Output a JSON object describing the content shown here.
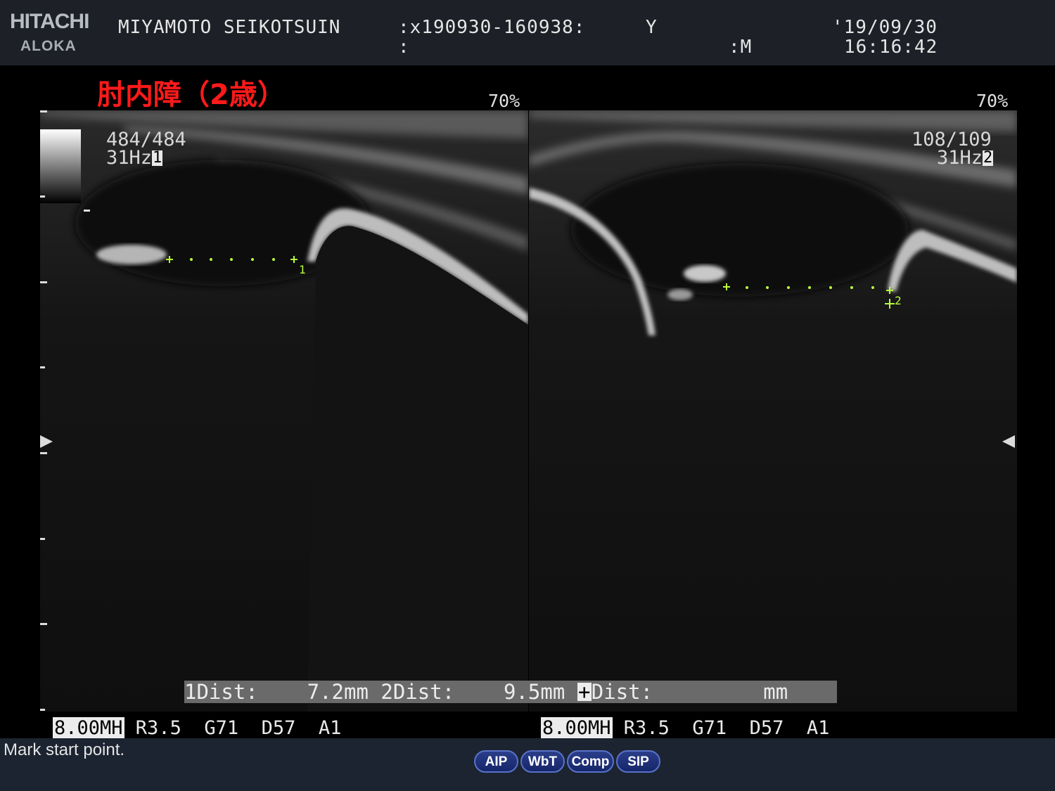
{
  "header": {
    "brand_top": "HITACHI",
    "brand_bottom": "ALOKA",
    "institution": "MIYAMOTO SEIKOTSUIN",
    "exam_id": ":x190930-160938:",
    "exam_line2": ":",
    "field_y": "Y",
    "field_m": ":M",
    "date": "'19/09/30",
    "time": "16:16:42"
  },
  "annotation_title": "肘内障（2歳）",
  "left_panel": {
    "percent": "70%",
    "frame_count": "484/484",
    "frame_rate": "31Hz",
    "frame_index": "1",
    "marker_label": "1"
  },
  "right_panel": {
    "percent": "70%",
    "frame_count": "108/109",
    "frame_rate": "31Hz",
    "frame_index": "2",
    "marker_label": "2"
  },
  "measurement": {
    "label1": "1Dist:",
    "value1": "7.2mm",
    "label2": "2Dist:",
    "value2": "9.5mm",
    "cursor": "+",
    "label3": "Dist:",
    "value3": "mm"
  },
  "params_left": {
    "freq": "8.00MH",
    "rest": " R3.5  G71  D57  A1"
  },
  "params_right": {
    "freq": "8.00MH",
    "rest": " R3.5  G71  D57  A1"
  },
  "status": {
    "message": "Mark start point."
  },
  "buttons": [
    {
      "label": "AIP"
    },
    {
      "label": "WbT"
    },
    {
      "label": "Comp"
    },
    {
      "label": "SIP"
    }
  ],
  "colors": {
    "caliper": "#b8ff3a",
    "title": "#ff1a1a",
    "button_fill": "#1f327a",
    "header_bg": "#1d2127"
  }
}
